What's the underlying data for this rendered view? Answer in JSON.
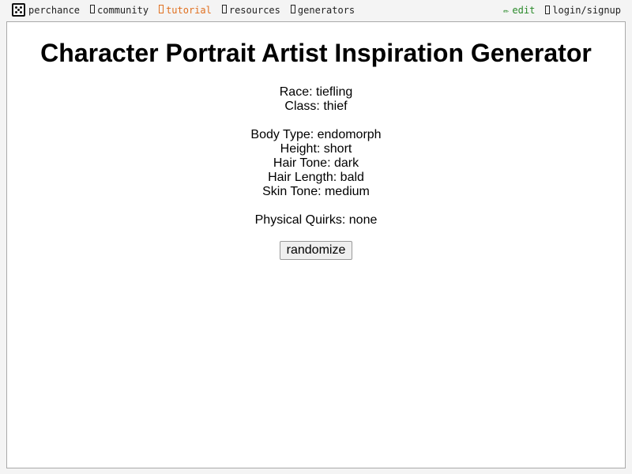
{
  "nav": {
    "brand": "perchance",
    "items": [
      {
        "label": "community",
        "icon": "community-icon"
      },
      {
        "label": "tutorial",
        "icon": "tutorial-icon",
        "color": "#e07020"
      },
      {
        "label": "resources",
        "icon": "resources-icon"
      },
      {
        "label": "generators",
        "icon": "generators-icon"
      }
    ],
    "edit": {
      "glyph": "✏",
      "label": "edit",
      "color": "#2a8a2a"
    },
    "login": {
      "label": "login/signup",
      "icon": "user-icon"
    }
  },
  "main": {
    "title": "Character Portrait Artist Inspiration Generator",
    "traits": {
      "race": "Race: tiefling",
      "class": "Class: thief",
      "body_type": "Body Type: endomorph",
      "height": "Height: short",
      "hair_tone": "Hair Tone: dark",
      "hair_length": "Hair Length: bald",
      "skin_tone": "Skin Tone: medium",
      "physical_quirks": "Physical Quirks: none"
    },
    "button_label": "randomize"
  }
}
